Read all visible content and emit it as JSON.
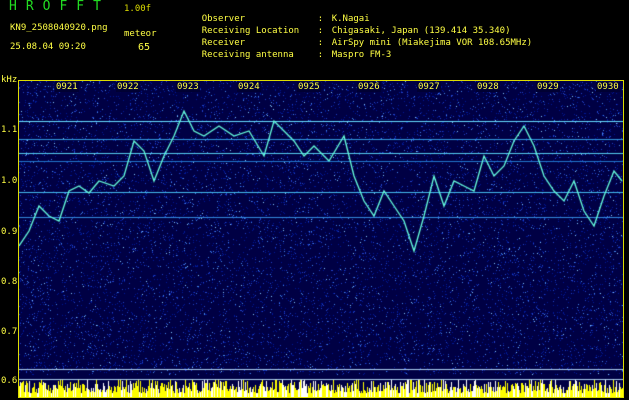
{
  "header": {
    "app_title": "HROFFT",
    "version": "1.00f",
    "file_name": "KN9_2508040920.png",
    "datetime": "25.08.04 09:20",
    "meteor_label": "meteor",
    "meteor_count": "65",
    "info": [
      {
        "key": "Observer",
        "value": "K.Nagai"
      },
      {
        "key": "Receiving Location",
        "value": "Chigasaki, Japan (139.414 35.340)"
      },
      {
        "key": "Receiver",
        "value": "AirSpy mini (Miakejima VOR 108.65MHz)"
      },
      {
        "key": "Receiving antenna",
        "value": "Maspro FM-3"
      }
    ]
  },
  "axis": {
    "unit": "kHz",
    "y_labels": [
      "1.1",
      "1.0",
      "0.9",
      "0.8",
      "0.7",
      "0.6"
    ],
    "time_labels": [
      "0921",
      "0922",
      "0923",
      "0924",
      "0925",
      "0926",
      "0927",
      "0928",
      "0929",
      "0930"
    ]
  },
  "colors": {
    "background": "#000000",
    "text": "#ffff44",
    "title": "#22dd22",
    "plot_noise_dark": "#000066",
    "plot_noise_light": "#2244cc",
    "signal": "#66ffdd",
    "carrier": "#55ddff",
    "bottom_bar": "#ffff00"
  }
}
